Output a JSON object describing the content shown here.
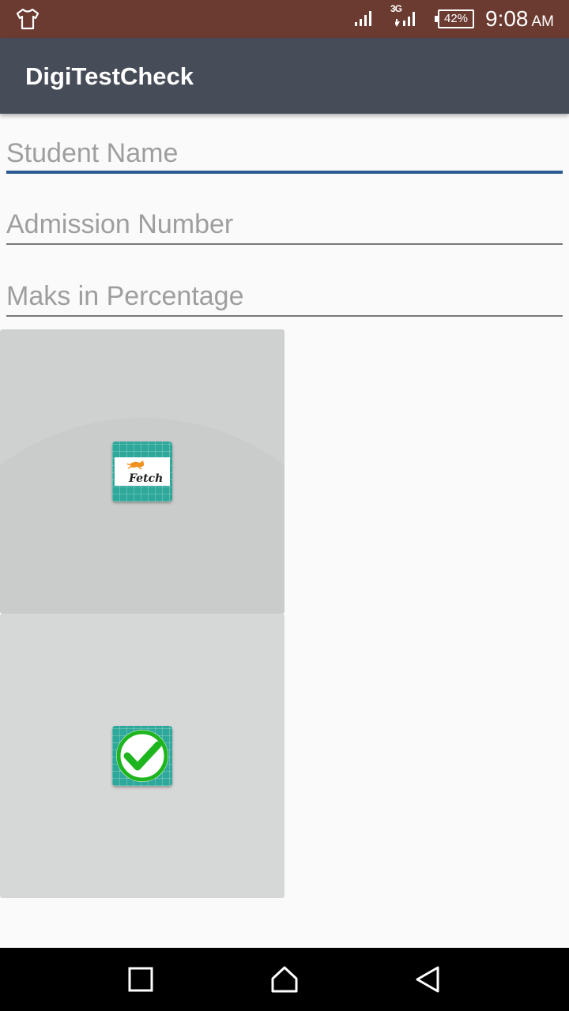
{
  "status_bar": {
    "battery": "42%",
    "time": "9:08",
    "ampm": "AM",
    "network_label": "3G",
    "icons": [
      "shirt-icon",
      "signal-icon",
      "3g-signal-icon",
      "battery-icon"
    ]
  },
  "app_bar": {
    "title": "DigiTestCheck"
  },
  "form": {
    "student_name_placeholder": "Student Name",
    "admission_number_placeholder": "Admission Number",
    "marks_placeholder": "Maks in Percentage"
  },
  "buttons": {
    "fetch": {
      "icon": "fetch-logo-icon",
      "logo_text": "Fetch"
    },
    "submit": {
      "icon": "green-check-icon"
    }
  },
  "nav_bar": {
    "icons": [
      "recents-square-icon",
      "home-icon",
      "back-icon"
    ]
  },
  "colors": {
    "status_bar": "#6b3a30",
    "app_bar": "#474d58",
    "focus_underline": "#2a5a8f",
    "tile": "#2ea89a",
    "check_green": "#1fb51f"
  }
}
